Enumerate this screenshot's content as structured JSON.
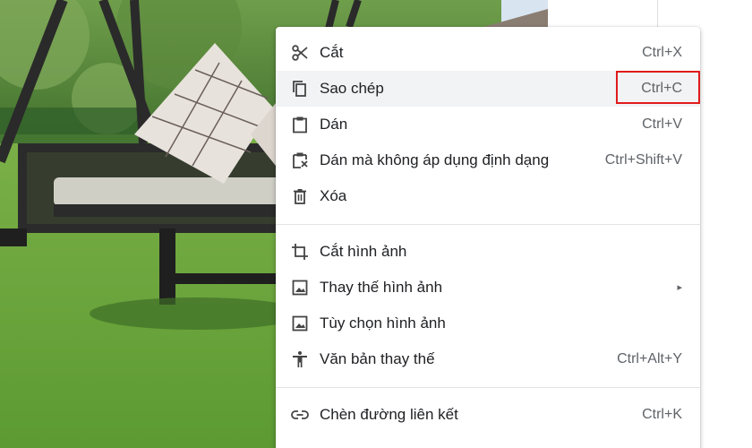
{
  "context_menu": {
    "items": [
      {
        "id": "cut",
        "label": "Cắt",
        "shortcut": "Ctrl+X",
        "icon": "scissors-icon"
      },
      {
        "id": "copy",
        "label": "Sao chép",
        "shortcut": "Ctrl+C",
        "icon": "copy-icon",
        "state": "hovered"
      },
      {
        "id": "paste",
        "label": "Dán",
        "shortcut": "Ctrl+V",
        "icon": "clipboard-icon"
      },
      {
        "id": "paste-plain",
        "label": "Dán mà không áp dụng định dạng",
        "shortcut": "Ctrl+Shift+V",
        "icon": "clipboard-clear-format-icon"
      },
      {
        "id": "delete",
        "label": "Xóa",
        "shortcut": "",
        "icon": "trash-icon"
      },
      {
        "id": "crop",
        "label": "Cắt hình ảnh",
        "shortcut": "",
        "icon": "crop-icon"
      },
      {
        "id": "replace",
        "label": "Thay thế hình ảnh",
        "shortcut": "",
        "icon": "image-icon",
        "submenu": "▸"
      },
      {
        "id": "options",
        "label": "Tùy chọn hình ảnh",
        "shortcut": "",
        "icon": "image-icon"
      },
      {
        "id": "alt-text",
        "label": "Văn bản thay thế",
        "shortcut": "Ctrl+Alt+Y",
        "icon": "accessibility-icon"
      },
      {
        "id": "link",
        "label": "Chèn đường liên kết",
        "shortcut": "Ctrl+K",
        "icon": "link-icon"
      }
    ]
  },
  "annotation": {
    "highlighted_item": "copy",
    "highlight_color": "#e11b1b"
  },
  "colors": {
    "menu_text": "#202124",
    "shortcut_text": "#5f6368",
    "hover_bg": "#f1f3f4",
    "lawn": "#5f9a3a"
  }
}
